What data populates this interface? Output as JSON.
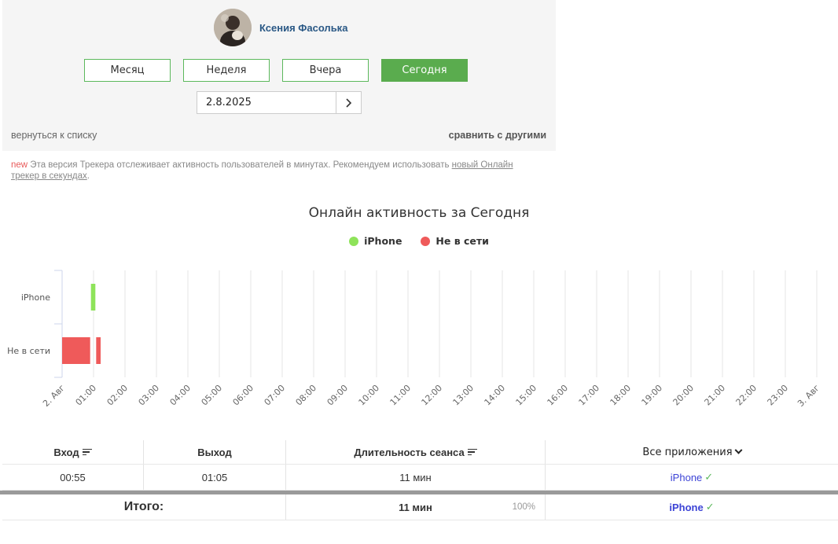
{
  "user": {
    "name": "Ксения Фасолька"
  },
  "periods": [
    {
      "label": "Месяц",
      "active": false
    },
    {
      "label": "Неделя",
      "active": false
    },
    {
      "label": "Вчера",
      "active": false
    },
    {
      "label": "Сегодня",
      "active": true
    }
  ],
  "date": {
    "value": "2.8.2025"
  },
  "links": {
    "back": "вернуться к списку",
    "compare": "сравнить с другими"
  },
  "notice": {
    "tag": "new",
    "text": " Эта версия Трекера отслеживает активность пользователей в минутах. Рекомендуем использовать ",
    "link": "новый Онлайн трекер в секундах",
    "tail": "."
  },
  "chart_data": {
    "type": "bar",
    "title": "Онлайн активность за Сегодня",
    "categories": [
      "iPhone",
      "Не в сети"
    ],
    "legend": [
      {
        "name": "iPhone",
        "color": "#8ee35a"
      },
      {
        "name": "Не в сети",
        "color": "#ef5a5a"
      }
    ],
    "x_ticks": [
      "2. Авг",
      "01:00",
      "02:00",
      "03:00",
      "04:00",
      "05:00",
      "06:00",
      "07:00",
      "08:00",
      "09:00",
      "10:00",
      "11:00",
      "12:00",
      "13:00",
      "14:00",
      "15:00",
      "16:00",
      "17:00",
      "18:00",
      "19:00",
      "20:00",
      "21:00",
      "22:00",
      "23:00",
      "3. Авг"
    ],
    "xlim_hours": [
      0,
      24
    ],
    "segments": [
      {
        "category": "iPhone",
        "start": 0.917,
        "end": 1.083,
        "color": "#8ee35a"
      },
      {
        "category": "Не в сети",
        "start": 0.0,
        "end": 0.917,
        "color": "#ef5a5a"
      },
      {
        "category": "Не в сети",
        "start": 1.083,
        "end": 1.25,
        "color": "#ef5a5a"
      }
    ],
    "grid": true
  },
  "table": {
    "headers": {
      "enter": "Вход",
      "exit": "Выход",
      "duration": "Длительность сеанса",
      "apps": "Все приложения"
    },
    "rows": [
      {
        "enter": "00:55",
        "exit": "01:05",
        "duration": "11 мин",
        "app": "iPhone"
      }
    ],
    "total": {
      "label": "Итого:",
      "duration": "11 мин",
      "percent": "100%",
      "app": "iPhone"
    }
  },
  "colors": {
    "accent": "#5aac4e",
    "link": "#2a5885",
    "app": "#3d44d6"
  }
}
